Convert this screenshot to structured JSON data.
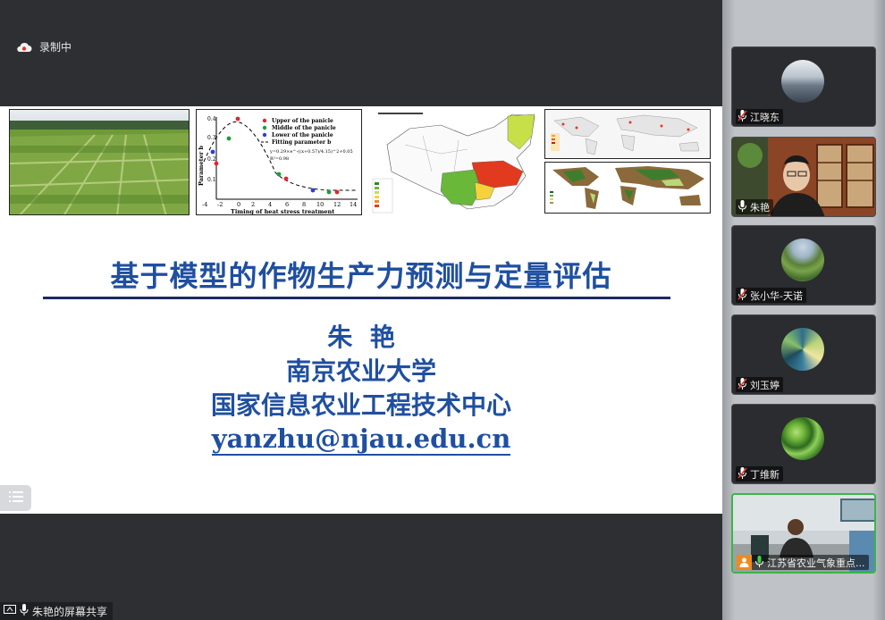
{
  "recording": {
    "label": "录制中",
    "icon": "cloud-record-icon"
  },
  "slide": {
    "title": "基于模型的作物生产力预测与定量评估",
    "author": "朱  艳",
    "affiliation1": "南京农业大学",
    "affiliation2": "国家信息农业工程技术中心",
    "email": "yanzhu@njau.edu.cn",
    "chart": {
      "legend": [
        "Upper of the panicle",
        "Middle of the panicle",
        "Lower of the panicle",
        "Fitting parameter b"
      ],
      "equation": "y=0.29×e^-((x+0.57)/4.15)^2+0.05",
      "r2": "R²=0.98",
      "xlabel": "Timing of heat stress treatment",
      "ylabel": "Parameter b",
      "xticks": [
        "-4",
        "-2",
        "0",
        "2",
        "4",
        "6",
        "8",
        "10",
        "12",
        "14"
      ],
      "yticks": [
        "0.4",
        "0.3",
        "0.2",
        "0.1"
      ]
    }
  },
  "toc_button": {
    "icon": "list-icon"
  },
  "screen_share": {
    "label": "朱艳的屏幕共享",
    "icon": "screen-share-icon"
  },
  "participants": [
    {
      "name": "江晓东",
      "muted": true,
      "video": false,
      "avatar": "sky-avatar"
    },
    {
      "name": "朱艳",
      "muted": false,
      "video": true,
      "avatar": "video-feed"
    },
    {
      "name": "张小华-天诺",
      "muted": true,
      "video": false,
      "avatar": "terraces-avatar"
    },
    {
      "name": "刘玉婷",
      "muted": true,
      "video": false,
      "avatar": "swirl-avatar"
    },
    {
      "name": "丁维新",
      "muted": true,
      "video": false,
      "avatar": "plant-avatar"
    },
    {
      "name": "江苏省农业气象重点...",
      "muted": false,
      "video": true,
      "avatar": "video-feed",
      "speaking": true
    }
  ]
}
